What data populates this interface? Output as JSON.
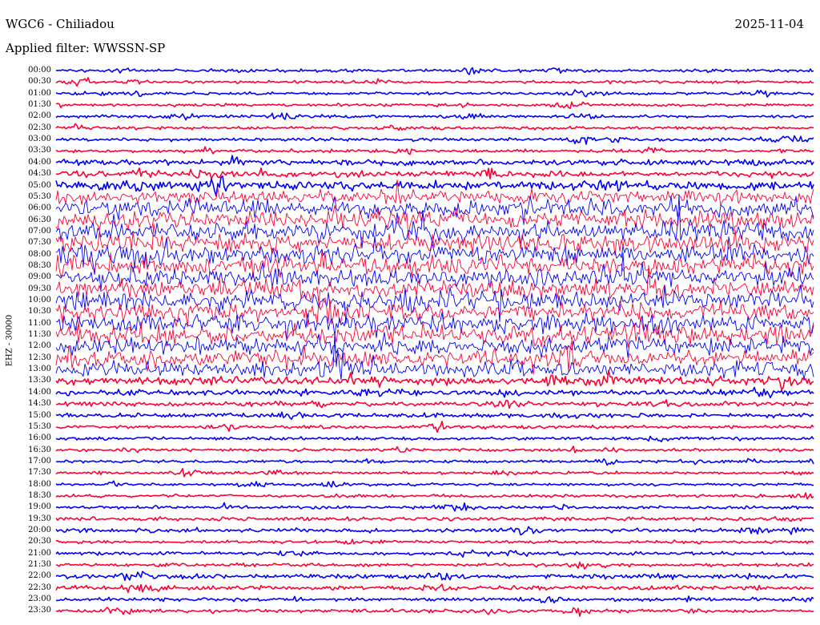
{
  "header": {
    "station": "WGC6 - Chiliadou",
    "date": "2025-11-04",
    "filter": "Applied filter: WWSSN-SP"
  },
  "chart_data": {
    "type": "line",
    "title": "WGC6 - Chiliadou",
    "channel_label": "EHZ - 30000",
    "line_labels": [
      "00:00",
      "00:30",
      "01:00",
      "01:30",
      "02:00",
      "02:30",
      "03:00",
      "03:30",
      "04:00",
      "04:30",
      "05:00",
      "05:30",
      "06:00",
      "06:30",
      "07:00",
      "07:30",
      "08:00",
      "08:30",
      "09:00",
      "09:30",
      "10:00",
      "10:30",
      "11:00",
      "11:30",
      "12:00",
      "12:30",
      "13:00",
      "13:30",
      "14:00",
      "14:30",
      "15:00",
      "15:30",
      "16:00",
      "16:30",
      "17:00",
      "17:30",
      "18:00",
      "18:30",
      "19:00",
      "19:30",
      "20:00",
      "20:30",
      "21:00",
      "21:30",
      "22:00",
      "22:30",
      "23:00",
      "23:30"
    ],
    "line_duration_minutes": 30,
    "series_colors": [
      "#0000ff",
      "#ff0033"
    ],
    "activity_level": [
      0.12,
      0.1,
      0.1,
      0.1,
      0.1,
      0.1,
      0.12,
      0.12,
      0.25,
      0.3,
      0.45,
      0.7,
      0.9,
      1.0,
      1.0,
      1.0,
      1.0,
      1.0,
      1.0,
      1.0,
      1.0,
      1.0,
      1.0,
      1.0,
      0.95,
      0.9,
      0.85,
      0.4,
      0.25,
      0.2,
      0.2,
      0.12,
      0.12,
      0.1,
      0.1,
      0.1,
      0.1,
      0.1,
      0.1,
      0.15,
      0.15,
      0.1,
      0.12,
      0.12,
      0.22,
      0.2,
      0.14,
      0.14
    ],
    "grid": false
  }
}
